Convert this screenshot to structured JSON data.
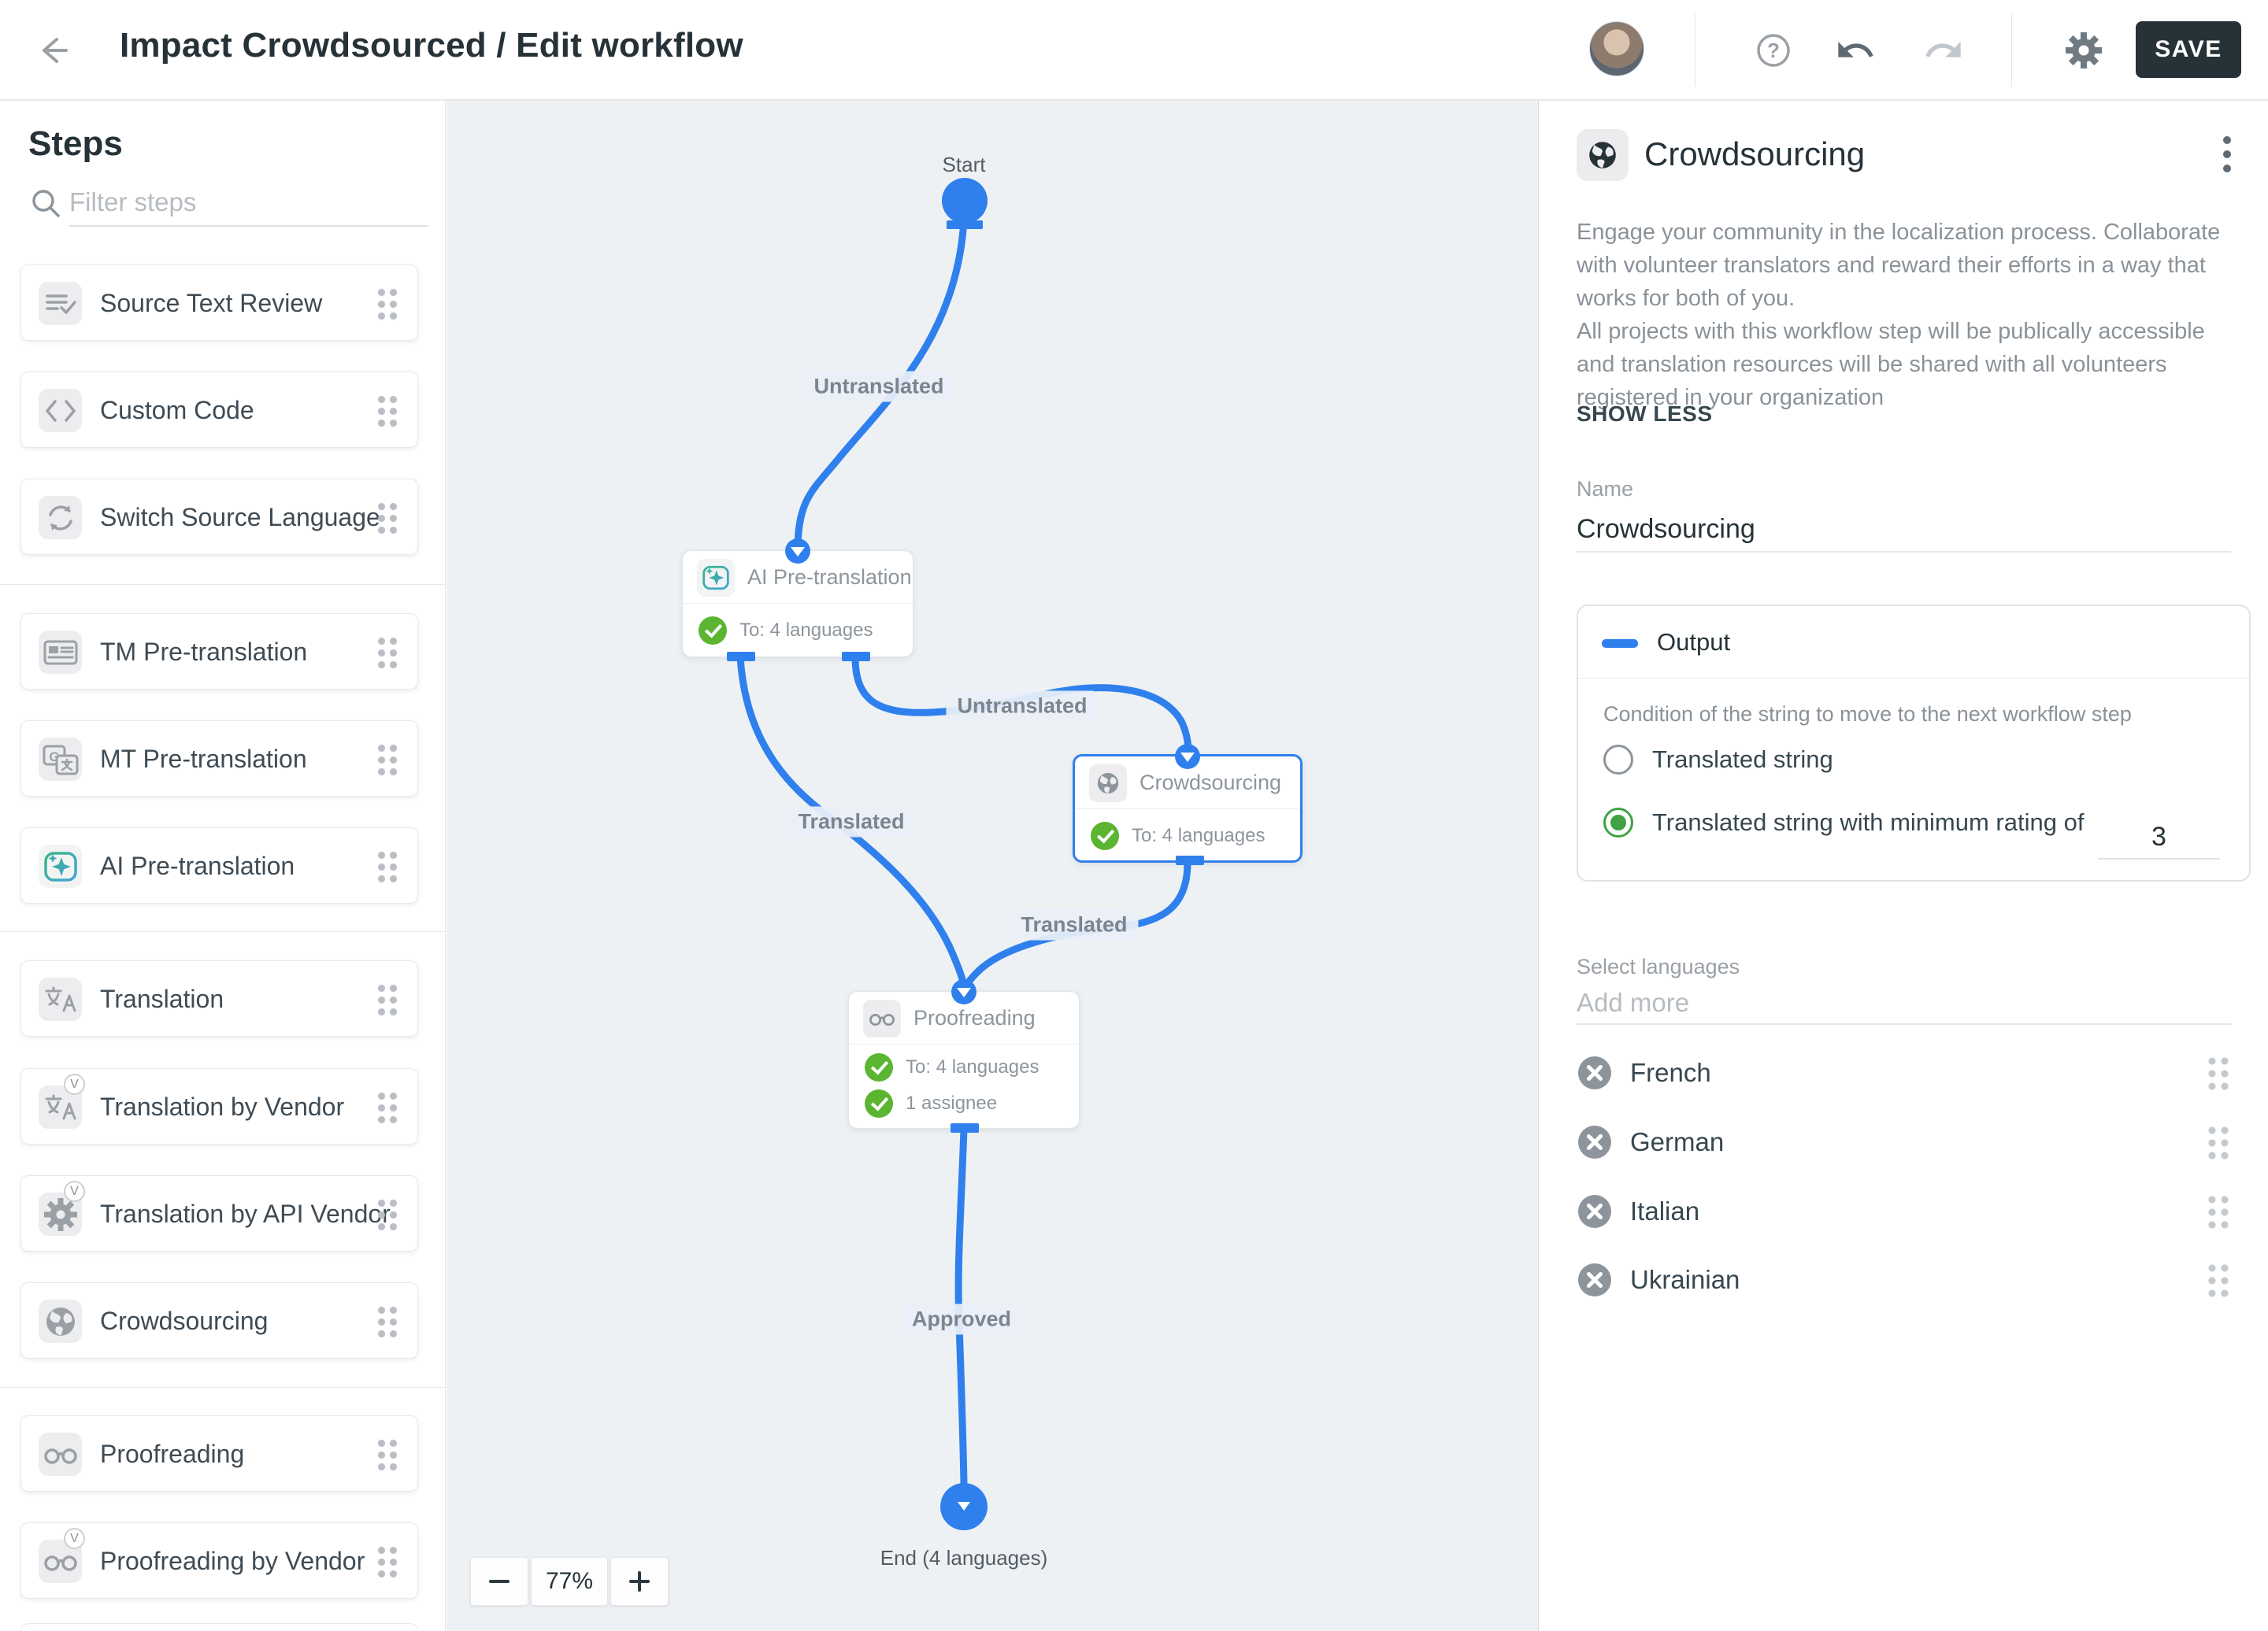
{
  "header": {
    "title": "Impact Crowdsourced / Edit workflow",
    "save_label": "SAVE"
  },
  "sidebar": {
    "heading": "Steps",
    "filter_placeholder": "Filter steps",
    "groups": [
      {
        "items": [
          {
            "label": "Source Text Review",
            "icon": "source-review-icon",
            "vendor": false
          },
          {
            "label": "Custom Code",
            "icon": "code-icon",
            "vendor": false
          },
          {
            "label": "Switch Source Language",
            "icon": "sync-icon",
            "vendor": false
          }
        ]
      },
      {
        "items": [
          {
            "label": "TM Pre-translation",
            "icon": "tm-icon",
            "vendor": false
          },
          {
            "label": "MT Pre-translation",
            "icon": "mt-icon",
            "vendor": false
          },
          {
            "label": "AI Pre-translation",
            "icon": "ai-sparkle-icon",
            "vendor": false
          }
        ]
      },
      {
        "items": [
          {
            "label": "Translation",
            "icon": "translate-icon",
            "vendor": false
          },
          {
            "label": "Translation by Vendor",
            "icon": "translate-icon",
            "vendor": true
          },
          {
            "label": "Translation by API Vendor",
            "icon": "gear-icon",
            "vendor": true
          },
          {
            "label": "Crowdsourcing",
            "icon": "globe-icon",
            "vendor": false
          }
        ]
      },
      {
        "items": [
          {
            "label": "Proofreading",
            "icon": "glasses-icon",
            "vendor": false
          },
          {
            "label": "Proofreading by Vendor",
            "icon": "glasses-icon",
            "vendor": true
          }
        ]
      }
    ]
  },
  "canvas": {
    "start_label": "Start",
    "end_label": "End (4 languages)",
    "zoom_level": "77%",
    "nodes": {
      "ai": {
        "title": "AI Pre-translation",
        "to": "To: 4 languages"
      },
      "crowd": {
        "title": "Crowdsourcing",
        "to": "To: 4 languages"
      },
      "proof": {
        "title": "Proofreading",
        "to": "To: 4 languages",
        "assignee": "1 assignee"
      }
    },
    "edge_labels": {
      "start_to_ai": "Untranslated",
      "ai_to_crowd": "Untranslated",
      "ai_to_proof": "Translated",
      "crowd_to_proof": "Translated",
      "proof_to_end": "Approved"
    }
  },
  "panel": {
    "title": "Crowdsourcing",
    "description1": "Engage your community in the localization process. Collaborate with volunteer translators and reward their efforts in a way that works for both of you.",
    "description2": "All projects with this workflow step will be publically accessible and translation resources will be shared with all volunteers registered in your organization",
    "show_less": "SHOW LESS",
    "name_label": "Name",
    "name_value": "Crowdsourcing",
    "output": {
      "title": "Output",
      "condition": "Condition of the string to move to the next workflow step",
      "option1": "Translated string",
      "option2": "Translated string with minimum rating of",
      "rating_value": "3"
    },
    "select_languages_label": "Select languages",
    "add_more_placeholder": "Add more",
    "languages": [
      "French",
      "German",
      "Italian",
      "Ukrainian"
    ]
  },
  "colors": {
    "accent_blue": "#2f80ed",
    "check_green": "#5cb531",
    "radio_green": "#3fa243",
    "dark": "#263238"
  }
}
